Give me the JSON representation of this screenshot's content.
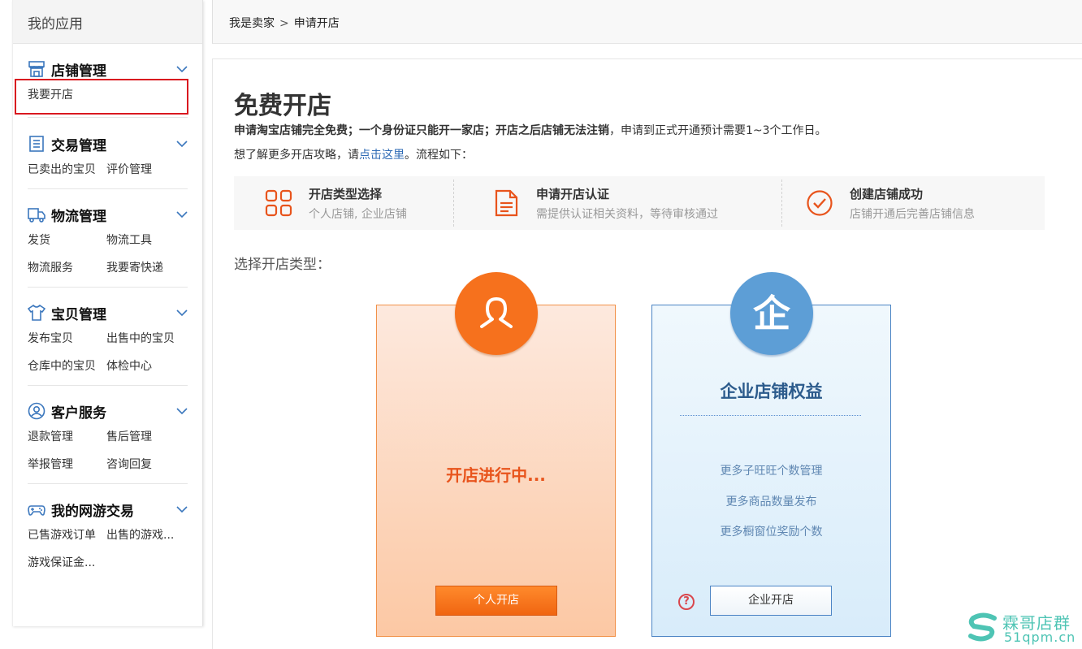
{
  "sidebar": {
    "title": "我的应用",
    "groups": [
      {
        "title": "店铺管理",
        "links": [
          "我要开店"
        ]
      },
      {
        "title": "交易管理",
        "links": [
          "已卖出的宝贝",
          "评价管理"
        ]
      },
      {
        "title": "物流管理",
        "links": [
          "发货",
          "物流工具",
          "物流服务",
          "我要寄快递"
        ]
      },
      {
        "title": "宝贝管理",
        "links": [
          "发布宝贝",
          "出售中的宝贝",
          "仓库中的宝贝",
          "体检中心"
        ]
      },
      {
        "title": "客户服务",
        "links": [
          "退款管理",
          "售后管理",
          "举报管理",
          "咨询回复"
        ]
      },
      {
        "title": "我的网游交易",
        "links": [
          "已售游戏订单",
          "出售的游戏...",
          "游戏保证金..."
        ]
      }
    ]
  },
  "breadcrumb": {
    "root": "我是卖家",
    "separator": ">",
    "current": "申请开店"
  },
  "main": {
    "title": "免费开店",
    "desc_bold": "申请淘宝店铺完全免费；一个身份证只能开一家店；开店之后店铺无法注销",
    "desc_rest": "，申请到正式开通预计需要1~3个工作日。",
    "guide_prefix": "想了解更多开店攻略，请",
    "guide_link": "点击这里",
    "guide_suffix": "。流程如下：",
    "steps": [
      {
        "title": "开店类型选择",
        "desc": "个人店铺, 企业店铺",
        "icon": "grid-icon"
      },
      {
        "title": "申请开店认证",
        "desc": "需提供认证相关资料，等待审核通过",
        "icon": "document-icon"
      },
      {
        "title": "创建店铺成功",
        "desc": "店铺开通后完善店铺信息",
        "icon": "check-circle-icon"
      }
    ],
    "choose_label": "选择开店类型：",
    "personal": {
      "status": "开店进行中...",
      "button": "个人开店",
      "icon": "person-icon"
    },
    "enterprise": {
      "title": "企业店铺权益",
      "benefits": [
        "更多子旺旺个数管理",
        "更多商品数量发布",
        "更多橱窗位奖励个数"
      ],
      "button": "企业开店",
      "help": "?",
      "icon": "enterprise-qi-icon",
      "badge_glyph": "企"
    }
  },
  "watermark": {
    "cn": "霖哥店群",
    "en": "51qpm.cn"
  },
  "colors": {
    "accent_orange": "#f6711d",
    "accent_blue": "#5d9ed6",
    "icon_blue": "#3b77bd",
    "step_icon": "#e8541c",
    "highlight_red": "#d9181f",
    "link_blue": "#2f6bb5"
  }
}
